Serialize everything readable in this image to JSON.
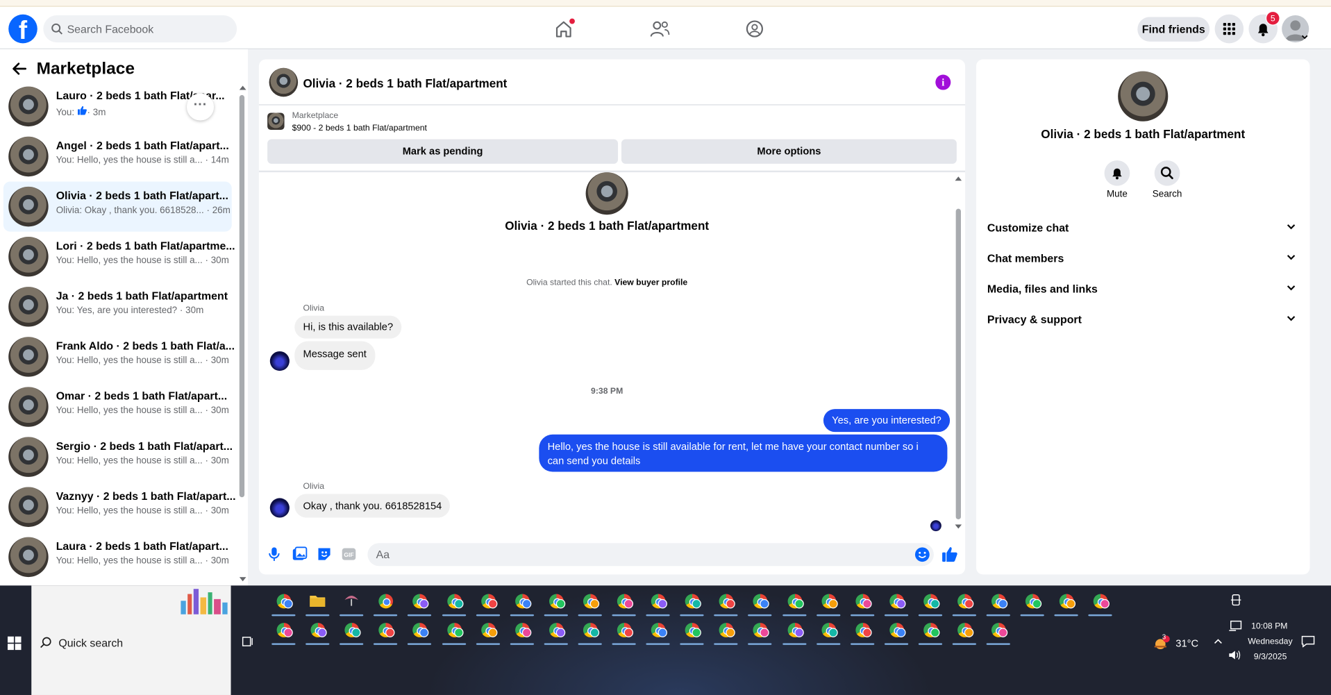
{
  "topbar": {
    "logo": "f",
    "search_placeholder": "Search Facebook",
    "find_friends": "Find friends",
    "notification_count": "5"
  },
  "left": {
    "title": "Marketplace",
    "conversations": [
      {
        "name": "Lauro · 2 beds 1 bath Flat/apar...",
        "preview_prefix": "You: ",
        "preview": "· 3m",
        "liked": true
      },
      {
        "name": "Angel · 2 beds 1 bath Flat/apart...",
        "preview": "You: Hello, yes the house is still a... · 14m"
      },
      {
        "name": "Olivia · 2 beds 1 bath Flat/apart...",
        "preview": "Olivia: Okay , thank you. 6618528... · 26m",
        "selected": true
      },
      {
        "name": "Lori · 2 beds 1 bath Flat/apartme...",
        "preview": "You: Hello, yes the house is still a... · 30m"
      },
      {
        "name": "Ja · 2 beds 1 bath Flat/apartment",
        "preview": "You: Yes, are you interested? · 30m"
      },
      {
        "name": "Frank Aldo · 2 beds 1 bath Flat/a...",
        "preview": "You: Hello, yes the house is still a... · 30m"
      },
      {
        "name": "Omar · 2 beds 1 bath Flat/apart...",
        "preview": "You: Hello, yes the house is still a... · 30m"
      },
      {
        "name": "Sergio · 2 beds 1 bath Flat/apart...",
        "preview": "You: Hello, yes the house is still a... · 30m"
      },
      {
        "name": "Vaznyy · 2 beds 1 bath Flat/apart...",
        "preview": "You: Hello, yes the house is still a... · 30m"
      },
      {
        "name": "Laura · 2 beds 1 bath Flat/apart...",
        "preview": "You: Hello, yes the house is still a... · 30m"
      }
    ]
  },
  "chat": {
    "title": "Olivia · 2 beds 1 bath Flat/apartment",
    "listing_label": "Marketplace",
    "listing_price": "$900 - 2 beds 1 bath Flat/apartment",
    "mark_pending": "Mark as pending",
    "more_options": "More options",
    "started_text": "Olivia started this chat.",
    "view_profile": "View buyer profile",
    "sender_name": "Olivia",
    "msg1": "Hi, is this available?",
    "msg2": "Message sent",
    "time": "9:38 PM",
    "out1": "Yes, are you interested?",
    "out2_line1": "Hello, yes the house is still available for rent, let me have your contact number so i",
    "out2_line2": "can send you details",
    "msg3": "Okay , thank you. 6618528154",
    "input_placeholder": "Aa"
  },
  "right": {
    "name": "Olivia · 2 beds 1 bath Flat/apartment",
    "mute": "Mute",
    "search": "Search",
    "sections": [
      "Customize chat",
      "Chat members",
      "Media, files and links",
      "Privacy & support"
    ]
  },
  "taskbar": {
    "quick_search": "Quick search",
    "temperature": "31°C",
    "weather_badge": "3",
    "time": "10:08 PM",
    "day": "Wednesday",
    "date": "9/3/2025"
  },
  "colors": {
    "accent": "#0866ff",
    "outgoing_bubble": "#1b4ef0",
    "info": "#a10fd9",
    "badge": "#e41e3f"
  }
}
